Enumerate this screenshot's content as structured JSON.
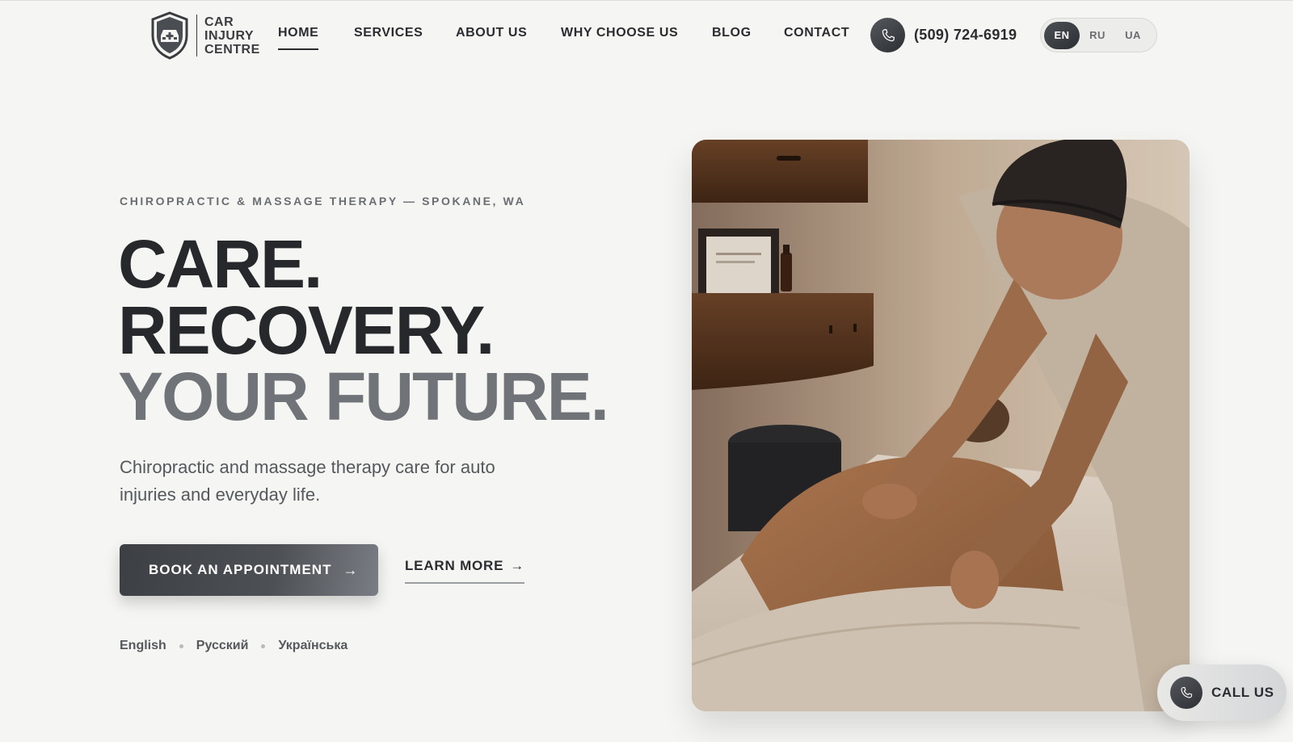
{
  "brand": {
    "name_lines": [
      "CAR",
      "INJURY",
      "CENTRE"
    ],
    "logo_icon": "shield-car-icon"
  },
  "nav": {
    "items": [
      {
        "label": "HOME",
        "active": true
      },
      {
        "label": "SERVICES",
        "active": false
      },
      {
        "label": "ABOUT US",
        "active": false
      },
      {
        "label": "WHY CHOOSE US",
        "active": false
      },
      {
        "label": "BLOG",
        "active": false
      },
      {
        "label": "CONTACT",
        "active": false
      }
    ]
  },
  "phone": {
    "icon": "phone-icon",
    "number": "(509) 724-6919"
  },
  "language_switch": {
    "options": [
      "EN",
      "RU",
      "UA"
    ],
    "selected": "EN"
  },
  "hero": {
    "eyebrow": "CHIROPRACTIC & MASSAGE THERAPY — SPOKANE, WA",
    "headline_1": "CARE.",
    "headline_2": "RECOVERY.",
    "headline_3": "YOUR FUTURE.",
    "subtitle": "Chiropractic and massage therapy care for auto injuries and everyday life.",
    "cta_primary": "BOOK AN APPOINTMENT",
    "cta_secondary": "LEARN MORE",
    "arrow_icon": "arrow-right-icon",
    "languages": [
      "English",
      "Русский",
      "Українська"
    ]
  },
  "floating": {
    "call_label": "CALL US",
    "icon": "phone-icon"
  },
  "colors": {
    "background": "#f5f5f3",
    "text_dark": "#26282c",
    "text_muted": "#707479",
    "button_dark": "#3c3f44"
  }
}
